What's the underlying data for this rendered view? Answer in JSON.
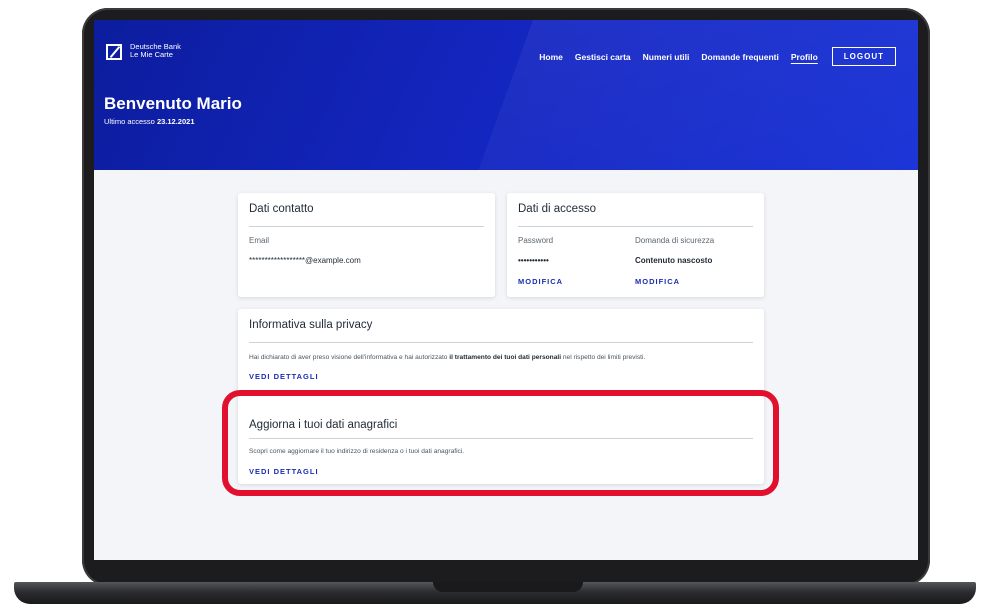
{
  "brand": {
    "line1": "Deutsche Bank",
    "line2": "Le Mie Carte"
  },
  "nav": {
    "items": [
      "Home",
      "Gestisci carta",
      "Numeri utili",
      "Domande frequenti",
      "Profilo"
    ],
    "active": "Profilo",
    "logout_label": "LOGOUT"
  },
  "header": {
    "welcome": "Benvenuto Mario",
    "last_access_label": "Ultimo accesso",
    "last_access_date": "23.12.2021"
  },
  "contact_card": {
    "title": "Dati contatto",
    "email_label": "Email",
    "email_value": "******************@example.com"
  },
  "access_card": {
    "title": "Dati di accesso",
    "password_label": "Password",
    "password_value": "•••••••••••",
    "password_action": "MODIFICA",
    "security_label": "Domanda di sicurezza",
    "security_value": "Contenuto nascosto",
    "security_action": "MODIFICA"
  },
  "privacy_card": {
    "title": "Informativa sulla privacy",
    "text_before": "Hai dichiarato di aver preso visione dell'informativa e hai autorizzato ",
    "text_bold": "il trattamento dei tuoi dati personali",
    "text_after": " nel rispetto dei limiti previsti.",
    "action": "VEDI DETTAGLI"
  },
  "update_card": {
    "title": "Aggiorna i tuoi dati anagrafici",
    "text": "Scopri come aggiornare il tuo indirizzo di residenza o i tuoi dati anagrafici.",
    "action": "VEDI DETTAGLI"
  },
  "colors": {
    "header_blue": "#1527c4",
    "link_blue": "#1a2fb0",
    "highlight_red": "#e0102e"
  }
}
